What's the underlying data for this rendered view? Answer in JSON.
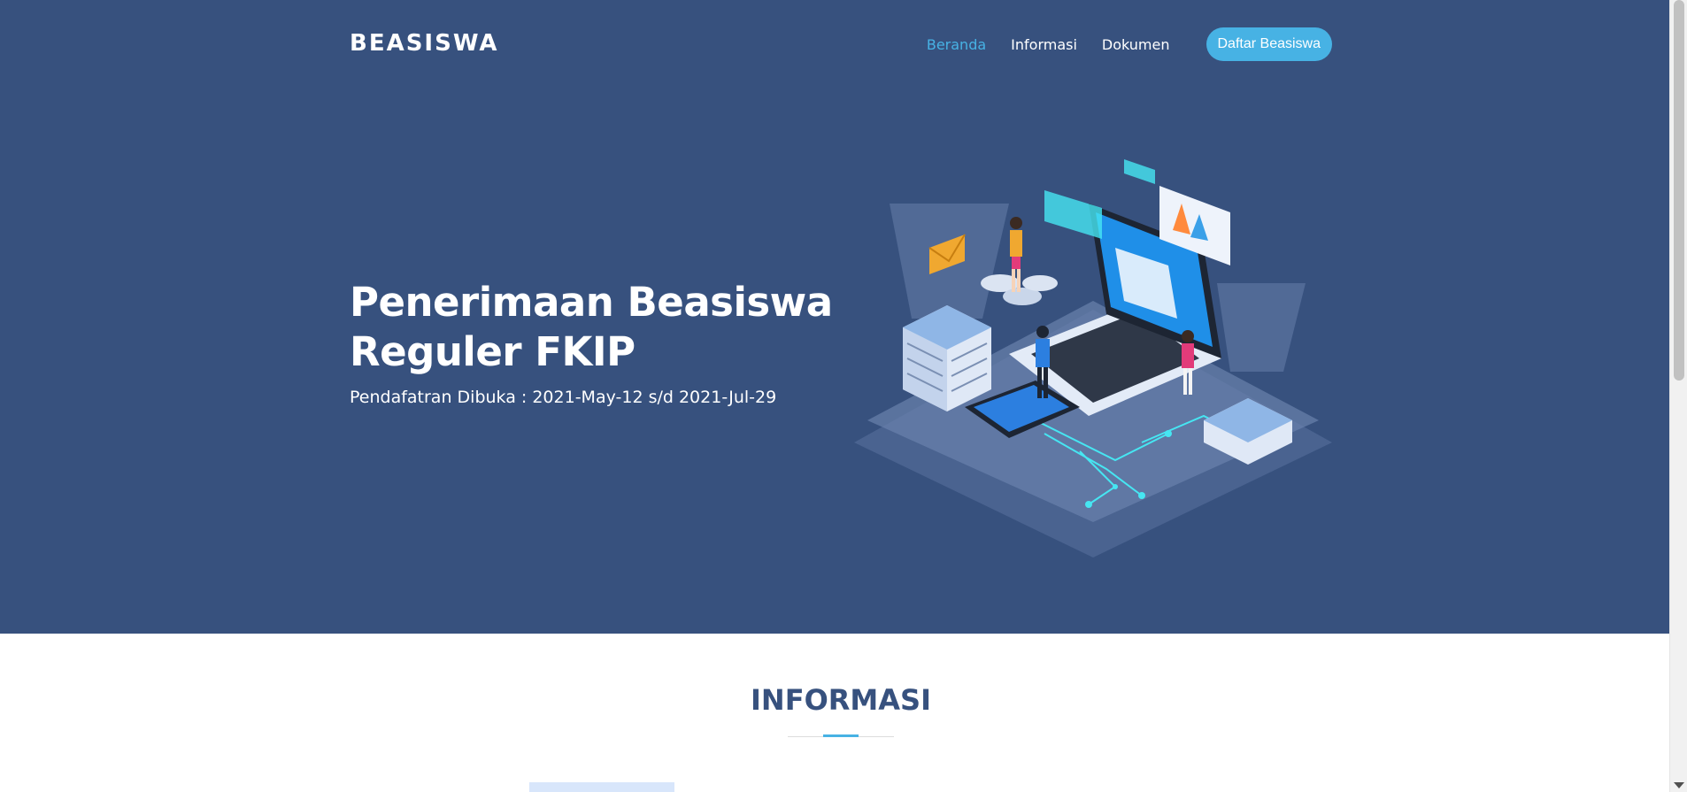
{
  "header": {
    "logo": "BEASISWA",
    "nav": [
      {
        "label": "Beranda",
        "active": true
      },
      {
        "label": "Informasi",
        "active": false
      },
      {
        "label": "Dokumen",
        "active": false
      }
    ],
    "cta_label": "Daftar Beasiswa"
  },
  "hero": {
    "title_line1": "Penerimaan Beasiswa",
    "title_line2": "Reguler FKIP",
    "subtitle": "Pendafatran Dibuka : 2021-May-12 s/d 2021-Jul-29"
  },
  "section": {
    "title": "INFORMASI"
  },
  "colors": {
    "hero_bg": "#37517e",
    "accent": "#47b2e4",
    "heading": "#37517e"
  }
}
